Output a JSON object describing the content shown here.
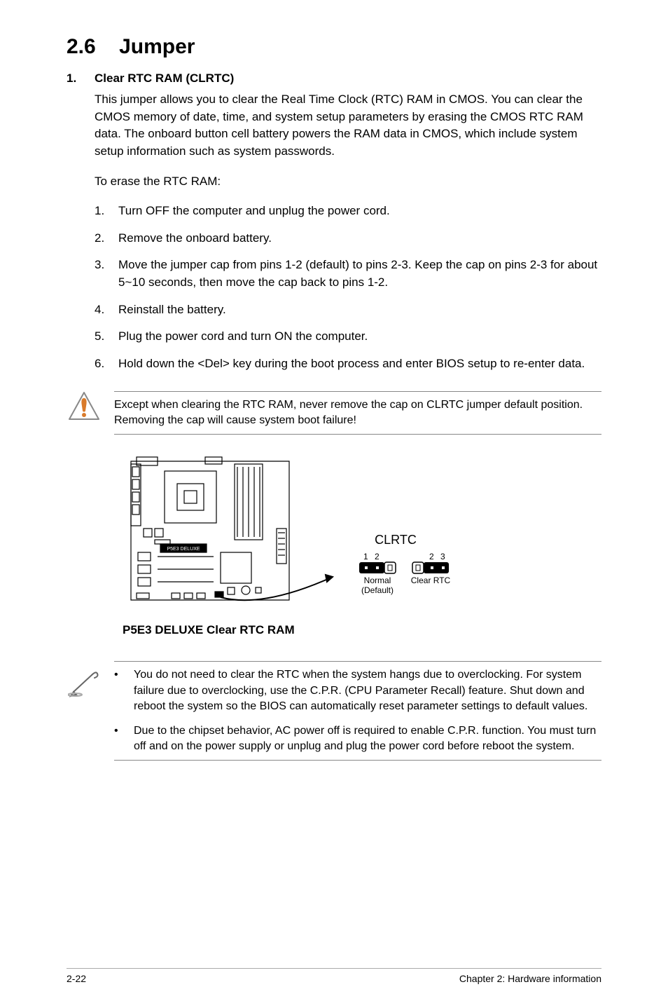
{
  "section": {
    "number": "2.6",
    "title": "Jumper"
  },
  "item1": {
    "num": "1.",
    "heading": "Clear RTC RAM (CLRTC)",
    "para1": "This jumper allows you to clear the  Real Time Clock (RTC) RAM in CMOS. You can clear the CMOS memory of date, time, and system setup parameters by erasing the CMOS RTC RAM data. The onboard button cell battery powers the RAM data in CMOS, which include system setup information such as system passwords.",
    "para2": "To erase the RTC RAM:",
    "steps": [
      "Turn OFF the computer and unplug the power cord.",
      "Remove the onboard battery.",
      "Move the jumper cap from pins 1-2 (default) to pins 2-3. Keep the cap on pins 2-3 for about 5~10 seconds, then move the cap back to pins 1-2.",
      "Reinstall the battery.",
      "Plug the power cord and turn ON the computer.",
      "Hold down the <Del> key during the boot process and enter BIOS setup to re-enter data."
    ]
  },
  "warning": {
    "text": "Except when clearing the RTC RAM, never remove the cap on CLRTC jumper default position. Removing the cap will cause system boot failure!"
  },
  "diagram": {
    "board_label": "P5E3 DELUXE",
    "pins_title": "CLRTC",
    "pin_left_nums": "1 2",
    "pin_left_label1": "Normal",
    "pin_left_label2": "(Default)",
    "pin_right_nums": "2 3",
    "pin_right_label": "Clear RTC",
    "caption": "P5E3 DELUXE Clear RTC RAM"
  },
  "notes": {
    "items": [
      "You do not need to clear the RTC when the system hangs due to overclocking. For system failure due to overclocking, use the C.P.R. (CPU Parameter Recall) feature. Shut down and reboot the system so the BIOS can automatically reset parameter settings to default values.",
      "Due to the chipset behavior, AC power off is required to enable C.P.R. function. You must turn off and on the power supply or unplug and plug the power cord before reboot the system."
    ]
  },
  "footer": {
    "left": "2-22",
    "right": "Chapter 2: Hardware information"
  }
}
